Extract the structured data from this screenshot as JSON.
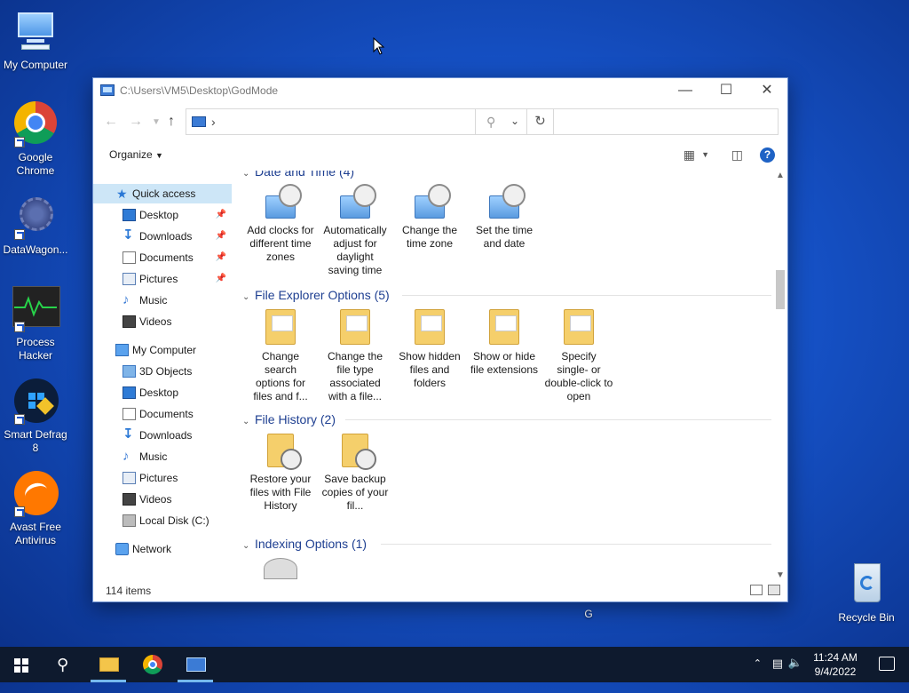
{
  "desktop": {
    "icons": [
      {
        "label": "My Computer"
      },
      {
        "label": "Google Chrome"
      },
      {
        "label": "DataWagon..."
      },
      {
        "label": "Process Hacker"
      },
      {
        "label": "Smart Defrag 8"
      },
      {
        "label": "Avast Free Antivirus"
      },
      {
        "label": "Recycle Bin"
      },
      {
        "label": "G"
      }
    ]
  },
  "window": {
    "title": "C:\\Users\\VM5\\Desktop\\GodMode",
    "address_sep": "›",
    "organize_label": "Organize",
    "status": "114 items"
  },
  "nav": {
    "items": [
      {
        "label": "Quick access"
      },
      {
        "label": "Desktop"
      },
      {
        "label": "Downloads"
      },
      {
        "label": "Documents"
      },
      {
        "label": "Pictures"
      },
      {
        "label": "Music"
      },
      {
        "label": "Videos"
      },
      {
        "label": "My Computer"
      },
      {
        "label": "3D Objects"
      },
      {
        "label": "Desktop"
      },
      {
        "label": "Documents"
      },
      {
        "label": "Downloads"
      },
      {
        "label": "Music"
      },
      {
        "label": "Pictures"
      },
      {
        "label": "Videos"
      },
      {
        "label": "Local Disk (C:)"
      },
      {
        "label": "Network"
      }
    ]
  },
  "content": {
    "groups": [
      {
        "header": "Date and Time (4)",
        "items": [
          {
            "label": "Add clocks for different time zones"
          },
          {
            "label": "Automatically adjust for daylight saving time"
          },
          {
            "label": "Change the time zone"
          },
          {
            "label": "Set the time and date"
          }
        ]
      },
      {
        "header": "File Explorer Options (5)",
        "items": [
          {
            "label": "Change search options for files and f..."
          },
          {
            "label": "Change the file type associated with a file..."
          },
          {
            "label": "Show hidden files and folders"
          },
          {
            "label": "Show or hide file extensions"
          },
          {
            "label": "Specify single- or double-click to open"
          }
        ]
      },
      {
        "header": "File History (2)",
        "items": [
          {
            "label": "Restore your files with File History"
          },
          {
            "label": "Save backup copies of your fil..."
          }
        ]
      },
      {
        "header": "Indexing Options (1)",
        "items": []
      }
    ]
  },
  "taskbar": {
    "time": "11:24 AM",
    "date": "9/4/2022"
  },
  "colors": {
    "accent": "#1e62c5",
    "selection": "#cde6f7",
    "taskbar": "#0e1a2e"
  }
}
